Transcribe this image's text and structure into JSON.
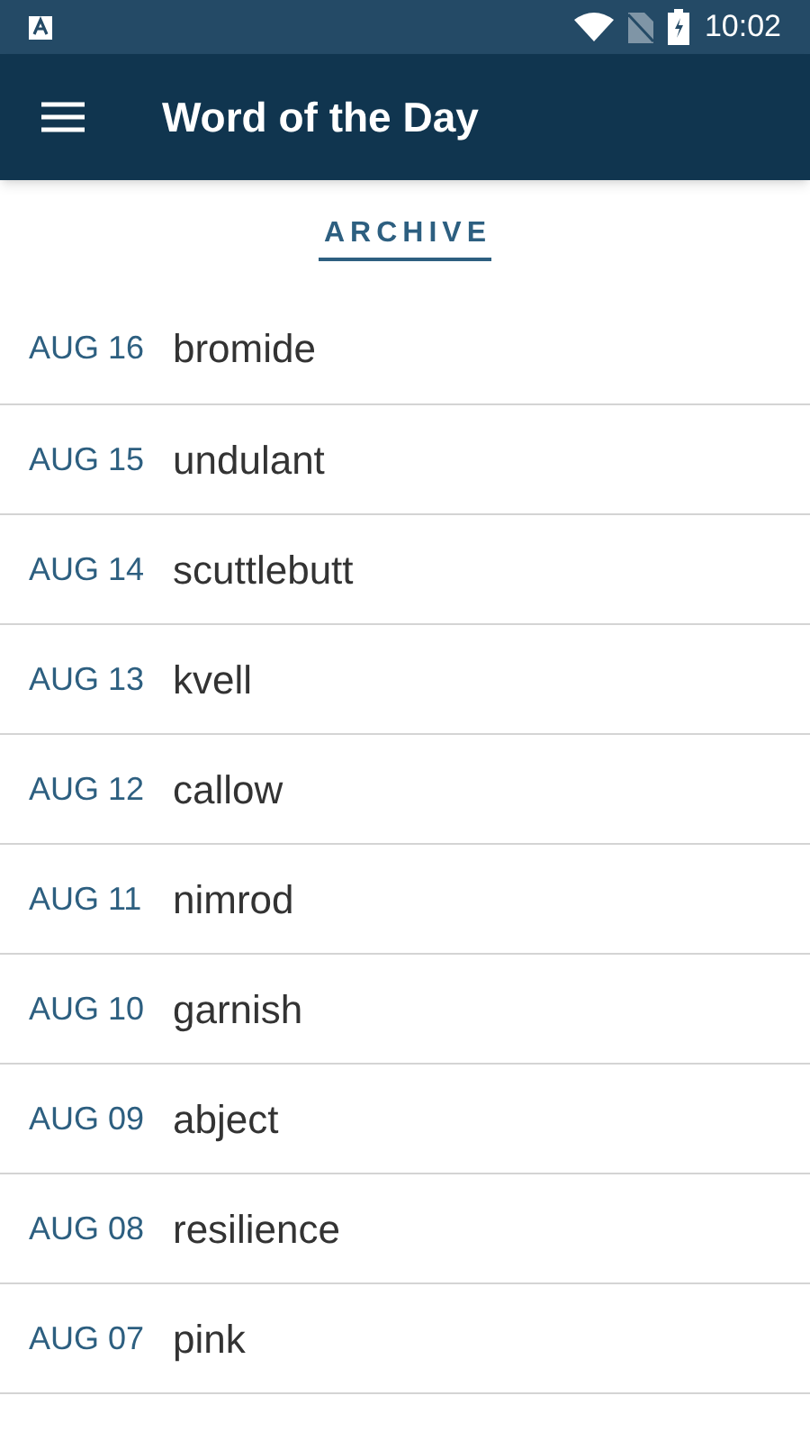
{
  "status_bar": {
    "time": "10:02"
  },
  "app_bar": {
    "title": "Word of the Day"
  },
  "section": {
    "title": "ARCHIVE"
  },
  "entries": [
    {
      "date": "AUG 16",
      "word": "bromide"
    },
    {
      "date": "AUG 15",
      "word": "undulant"
    },
    {
      "date": "AUG 14",
      "word": "scuttlebutt"
    },
    {
      "date": "AUG 13",
      "word": "kvell"
    },
    {
      "date": "AUG 12",
      "word": "callow"
    },
    {
      "date": "AUG 11",
      "word": "nimrod"
    },
    {
      "date": "AUG 10",
      "word": "garnish"
    },
    {
      "date": "AUG 09",
      "word": "abject"
    },
    {
      "date": "AUG 08",
      "word": "resilience"
    },
    {
      "date": "AUG 07",
      "word": "pink"
    }
  ]
}
